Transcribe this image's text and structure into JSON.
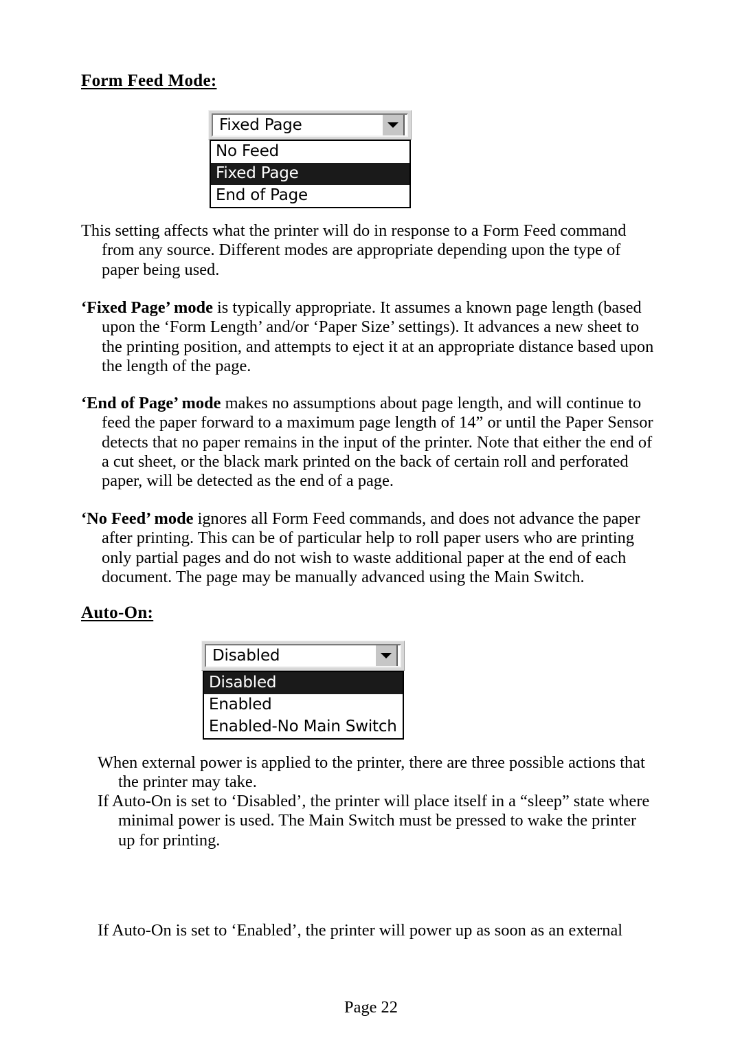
{
  "document": {
    "footer": "Page 22"
  },
  "sections": [
    {
      "heading": "Form Feed Mode:",
      "control": {
        "type": "combobox",
        "name": "form-feed-mode",
        "selected_value": "Fixed Page",
        "expanded": true,
        "arrow_icon": "chevron-down-icon",
        "options": [
          {
            "label": "No Feed",
            "selected": false
          },
          {
            "label": "Fixed Page",
            "selected": true
          },
          {
            "label": "End of Page",
            "selected": false
          }
        ]
      }
    },
    {
      "heading": "Auto-On:",
      "control": {
        "type": "combobox",
        "name": "auto-on",
        "selected_value": "Disabled",
        "expanded": true,
        "arrow_icon": "chevron-down-icon",
        "options": [
          {
            "label": "Disabled",
            "selected": true
          },
          {
            "label": "Enabled",
            "selected": false
          },
          {
            "label": "Enabled-No Main Switch",
            "selected": false
          }
        ]
      }
    }
  ],
  "paragraphs": {
    "intro": "This setting affects what the printer will do in response to a Form Feed command from any source.  Different modes are appropriate depending upon the type of paper being used.",
    "fixed_page_lead": "‘Fixed Page’ mode",
    "fixed_page_rest": " is typically appropriate.  It assumes a known page length (based upon the ‘Form Length’ and/or ‘Paper Size’ settings).  It advances a new sheet to the printing position, and attempts to eject it at an appropriate distance based upon the length of the page.",
    "end_of_page_lead": "‘End of Page’ mode",
    "end_of_page_rest": " makes no assumptions about page length, and will continue to feed the paper forward to a maximum page length of 14” or until the Paper Sensor detects that no paper remains in the input of the printer.  Note that either the end of a cut sheet, or the black mark printed on the back of certain roll and perforated paper, will be detected as the end of a page.",
    "no_feed_lead": "‘No Feed’ mode",
    "no_feed_rest": " ignores all Form Feed commands, and does not advance the paper after printing.  This can be of particular help to roll paper users who are printing only partial pages and do not wish to waste additional paper at the end of each document.  The page may be manually advanced using the Main Switch.",
    "auto_on_intro": "When external power is applied to the printer, there are three possible actions that the printer may take.",
    "auto_on_disabled": "If Auto-On is set to ‘Disabled’, the printer will place itself in a “sleep” state where minimal power is used.  The Main Switch must be pressed to wake the printer up for printing.",
    "auto_on_enabled": "If Auto-On is set to ‘Enabled’, the printer will power up as soon as an external"
  }
}
